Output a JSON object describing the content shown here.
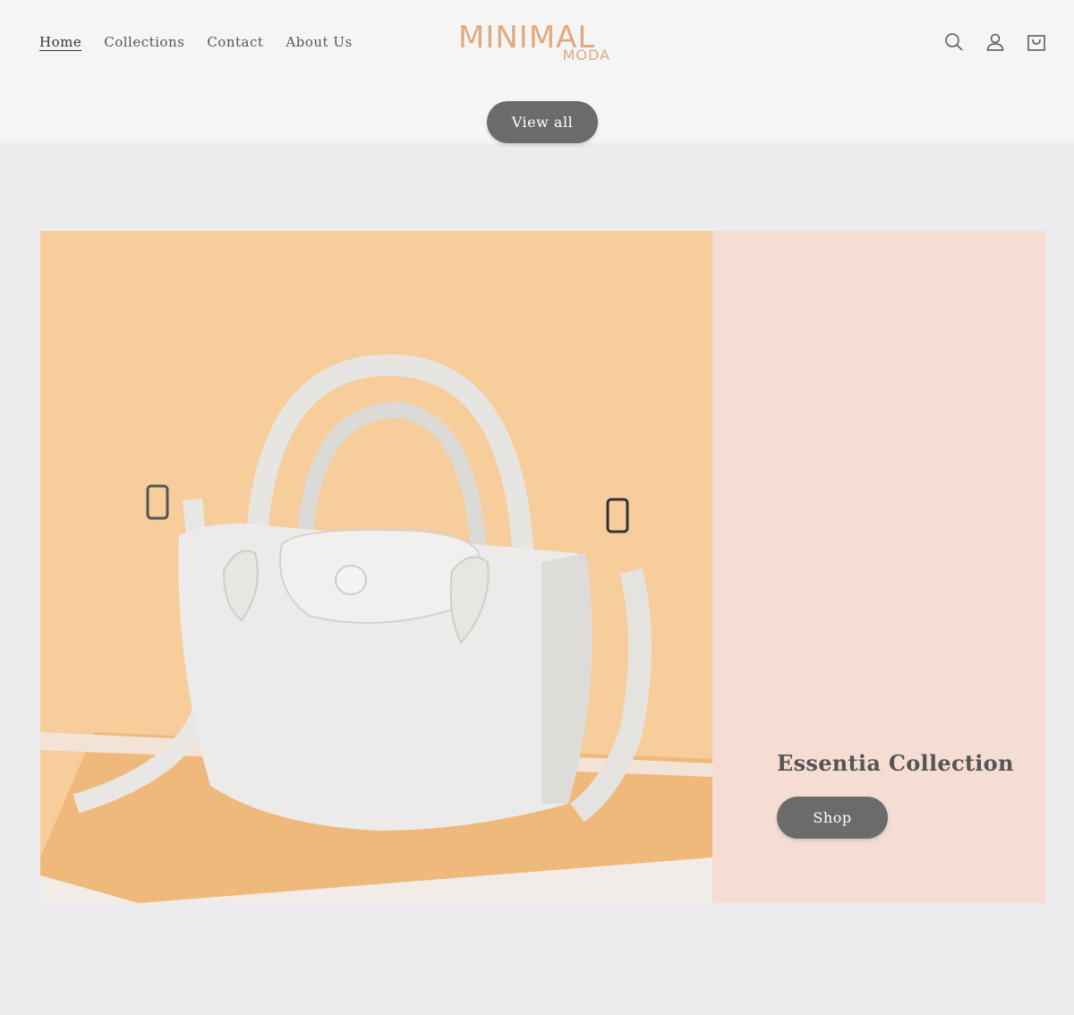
{
  "header": {
    "nav": [
      {
        "label": "Home",
        "active": true
      },
      {
        "label": "Collections",
        "active": false
      },
      {
        "label": "Contact",
        "active": false
      },
      {
        "label": "About Us",
        "active": false
      }
    ],
    "logo": {
      "main": "MINIMAL",
      "sub": "MODA"
    },
    "icons": [
      "search-icon",
      "account-icon",
      "cart-icon"
    ]
  },
  "view_all_label": "View all",
  "banner": {
    "title": "Essentia Collection",
    "button_label": "Shop",
    "image": "white-leather-handbag",
    "colors": {
      "image_bg": "#f7cd9b",
      "panel_bg": "#f5ddd3"
    }
  },
  "colors": {
    "accent": "#e1a97e",
    "button": "#6b6b6b",
    "page_bg": "#ececee",
    "header_bg": "#f5f5f5"
  }
}
